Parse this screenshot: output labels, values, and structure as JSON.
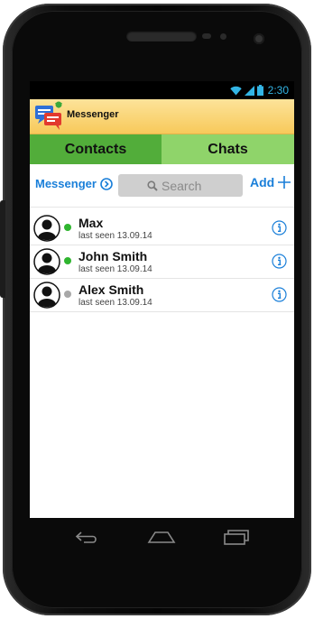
{
  "status": {
    "time": "2:30"
  },
  "app": {
    "title": "Messenger"
  },
  "tabs": [
    {
      "label": "Contacts",
      "selected": true
    },
    {
      "label": "Chats",
      "selected": false
    }
  ],
  "toolbar": {
    "messenger_label": "Messenger",
    "search_placeholder": "Search",
    "add_label": "Add"
  },
  "contacts": [
    {
      "name": "Max",
      "last_seen": "last seen 13.09.14",
      "status": "online"
    },
    {
      "name": "John Smith",
      "last_seen": "last seen 13.09.14",
      "status": "online"
    },
    {
      "name": "Alex Smith",
      "last_seen": "last seen 13.09.14",
      "status": "offline"
    }
  ],
  "colors": {
    "accent": "#1a7fd9",
    "tab_selected": "#52ad3a",
    "tab_unselected": "#8fd46a",
    "online": "#2fb52f",
    "offline": "#a8a8a8",
    "appbar": "#f9d26f"
  },
  "icons": {
    "wifi": "wifi-icon",
    "signal": "signal-icon",
    "battery": "battery-icon",
    "back": "back-icon",
    "home": "home-icon",
    "recents": "recents-icon"
  }
}
